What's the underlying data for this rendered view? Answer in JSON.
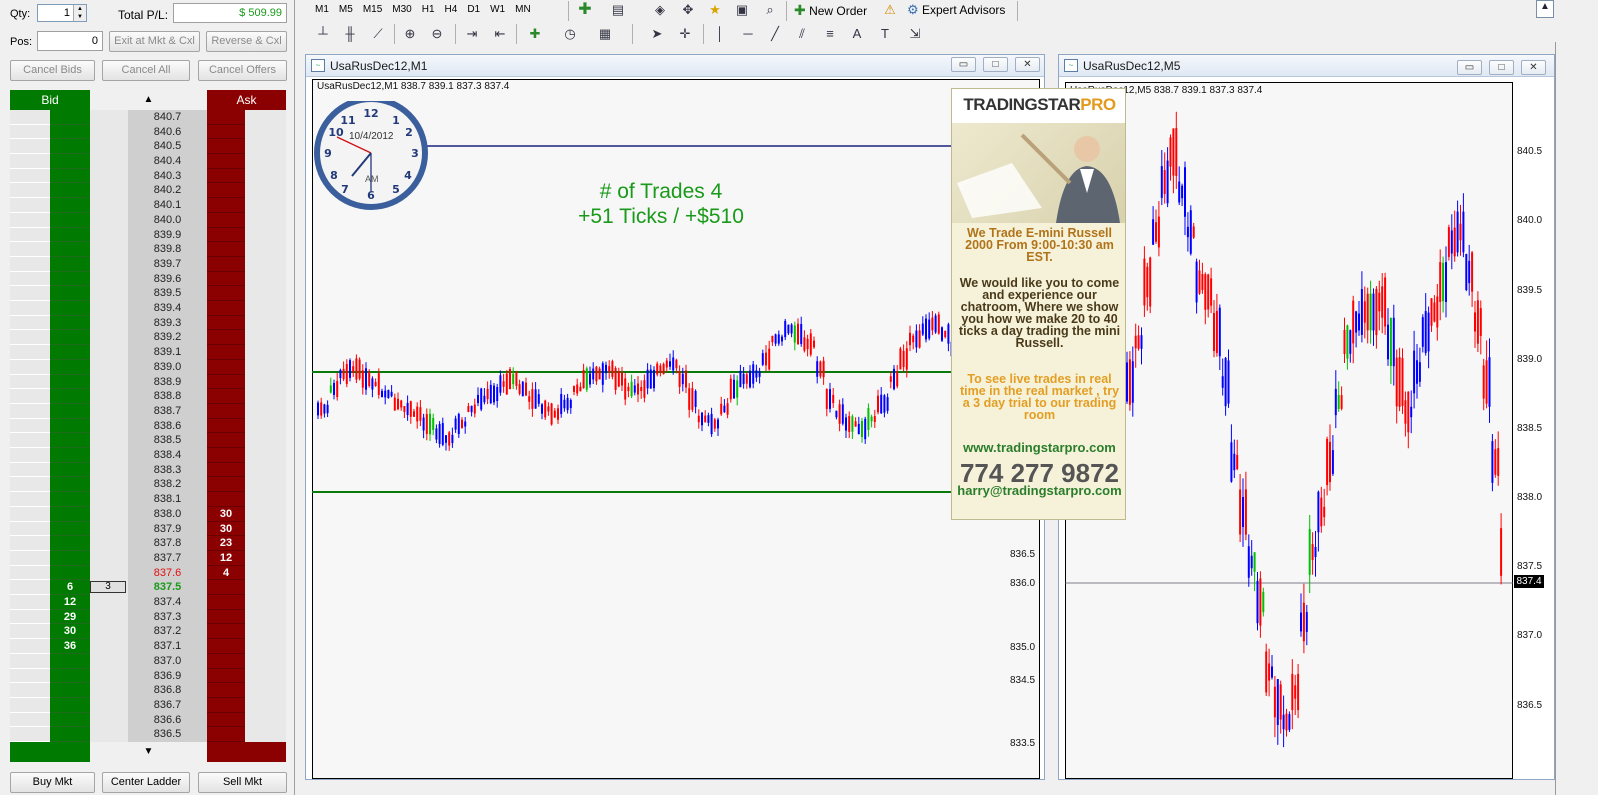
{
  "dom": {
    "qty_label": "Qty:",
    "qty_value": "1",
    "total_pl_label": "Total P/L:",
    "total_pl_value": "$ 509.99",
    "pos_label": "Pos:",
    "pos_value": "0",
    "exit_button": "Exit at Mkt & Cxl",
    "reverse_button": "Reverse & Cxl",
    "cancel_bids": "Cancel Bids",
    "cancel_all": "Cancel All",
    "cancel_offers": "Cancel Offers",
    "bid_header": "Bid",
    "ask_header": "Ask",
    "up_arrow": "▲",
    "down_arrow": "▼",
    "position_marker": "3",
    "last_price": "837.5",
    "ask_price_hi": "837.6",
    "bottom_buttons": [
      "Buy Mkt",
      "Center Ladder",
      "Sell Mkt"
    ],
    "rows": [
      {
        "price": "840.7",
        "bid": "",
        "ask": ""
      },
      {
        "price": "840.6",
        "bid": "",
        "ask": ""
      },
      {
        "price": "840.5",
        "bid": "",
        "ask": ""
      },
      {
        "price": "840.4",
        "bid": "",
        "ask": ""
      },
      {
        "price": "840.3",
        "bid": "",
        "ask": ""
      },
      {
        "price": "840.2",
        "bid": "",
        "ask": ""
      },
      {
        "price": "840.1",
        "bid": "",
        "ask": ""
      },
      {
        "price": "840.0",
        "bid": "",
        "ask": ""
      },
      {
        "price": "839.9",
        "bid": "",
        "ask": ""
      },
      {
        "price": "839.8",
        "bid": "",
        "ask": ""
      },
      {
        "price": "839.7",
        "bid": "",
        "ask": ""
      },
      {
        "price": "839.6",
        "bid": "",
        "ask": ""
      },
      {
        "price": "839.5",
        "bid": "",
        "ask": ""
      },
      {
        "price": "839.4",
        "bid": "",
        "ask": ""
      },
      {
        "price": "839.3",
        "bid": "",
        "ask": ""
      },
      {
        "price": "839.2",
        "bid": "",
        "ask": ""
      },
      {
        "price": "839.1",
        "bid": "",
        "ask": ""
      },
      {
        "price": "839.0",
        "bid": "",
        "ask": ""
      },
      {
        "price": "838.9",
        "bid": "",
        "ask": ""
      },
      {
        "price": "838.8",
        "bid": "",
        "ask": ""
      },
      {
        "price": "838.7",
        "bid": "",
        "ask": ""
      },
      {
        "price": "838.6",
        "bid": "",
        "ask": ""
      },
      {
        "price": "838.5",
        "bid": "",
        "ask": ""
      },
      {
        "price": "838.4",
        "bid": "",
        "ask": ""
      },
      {
        "price": "838.3",
        "bid": "",
        "ask": ""
      },
      {
        "price": "838.2",
        "bid": "",
        "ask": ""
      },
      {
        "price": "838.1",
        "bid": "",
        "ask": ""
      },
      {
        "price": "838.0",
        "bid": "",
        "ask": "30"
      },
      {
        "price": "837.9",
        "bid": "",
        "ask": "30"
      },
      {
        "price": "837.8",
        "bid": "",
        "ask": "23"
      },
      {
        "price": "837.7",
        "bid": "",
        "ask": "12"
      },
      {
        "price": "837.6",
        "bid": "",
        "ask": "4"
      },
      {
        "price": "837.5",
        "bid": "6",
        "ask": ""
      },
      {
        "price": "837.4",
        "bid": "12",
        "ask": ""
      },
      {
        "price": "837.3",
        "bid": "29",
        "ask": ""
      },
      {
        "price": "837.2",
        "bid": "30",
        "ask": ""
      },
      {
        "price": "837.1",
        "bid": "36",
        "ask": ""
      },
      {
        "price": "837.0",
        "bid": "",
        "ask": ""
      },
      {
        "price": "836.9",
        "bid": "",
        "ask": ""
      },
      {
        "price": "836.8",
        "bid": "",
        "ask": ""
      },
      {
        "price": "836.7",
        "bid": "",
        "ask": ""
      },
      {
        "price": "836.6",
        "bid": "",
        "ask": ""
      },
      {
        "price": "836.5",
        "bid": "",
        "ask": ""
      }
    ]
  },
  "toolbar": {
    "timeframes": [
      "M1",
      "M5",
      "M15",
      "M30",
      "H1",
      "H4",
      "D1",
      "W1",
      "MN"
    ],
    "new_order": "New Order",
    "expert_advisors": "Expert Advisors",
    "text_tool": "A"
  },
  "chart_m1": {
    "title": "UsaRusDec12,M1",
    "ohlc": "UsaRusDec12,M1  838.7 839.1 837.3 837.4",
    "clock_date": "10/4/2012",
    "clock_am": "AM",
    "trades_line1": "# of Trades 4",
    "trades_line2": "+51 Ticks / +$510",
    "axis_labels": [
      "836.5",
      "836.0",
      "835.0",
      "834.5",
      "833.5"
    ]
  },
  "chart_m5": {
    "title": "UsaRusDec12,M5",
    "ohlc": "UsaRusDec12,M5  838.7 839.1 837.3 837.4",
    "axis_labels": [
      "840.5",
      "840.0",
      "839.5",
      "839.0",
      "838.5",
      "838.0",
      "837.5",
      "837.0",
      "836.5"
    ],
    "current_price": "837.4"
  },
  "ad": {
    "logo_a": "TRADINGSTAR",
    "logo_b": "PRO",
    "line1": "We Trade E-mini Russell 2000 From 9:00-10:30 am EST.",
    "line2": "We would like you to come and experience our chatroom, Where we show you how we make 20 to 40 ticks a day trading the mini Russell.",
    "line3": "To see live trades in real time in the real market , try a 3 day trial to our trading room",
    "website": "www.tradingstarpro.com",
    "phone": "774 277 9872",
    "email": "harry@tradingstarpro.com"
  },
  "colors": {
    "bid_green": "#007a00",
    "ask_red": "#8b0000",
    "bull_candle": "#0000ff",
    "bear_candle": "#ff0000",
    "doji": "#00c000",
    "trades_text": "#1a9a1a",
    "pl_green": "#1a9a1a"
  }
}
